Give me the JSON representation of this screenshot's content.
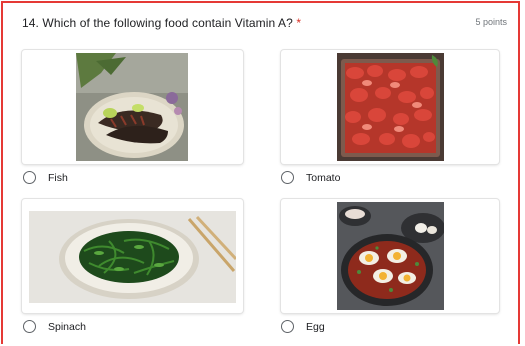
{
  "question": {
    "number_text": "14. Which of the following food contain Vitamin A?",
    "required_marker": "*",
    "points": "5 points"
  },
  "options": [
    {
      "label": "Fish",
      "image_icon": "fish-dish-photo"
    },
    {
      "label": "Tomato",
      "image_icon": "tomato-tray-photo"
    },
    {
      "label": "Spinach",
      "image_icon": "spinach-bowl-photo"
    },
    {
      "label": "Egg",
      "image_icon": "egg-shakshuka-photo"
    }
  ],
  "colors": {
    "frame_border": "#e53935",
    "required_star": "#d93025",
    "radio_border": "#5f6368"
  }
}
